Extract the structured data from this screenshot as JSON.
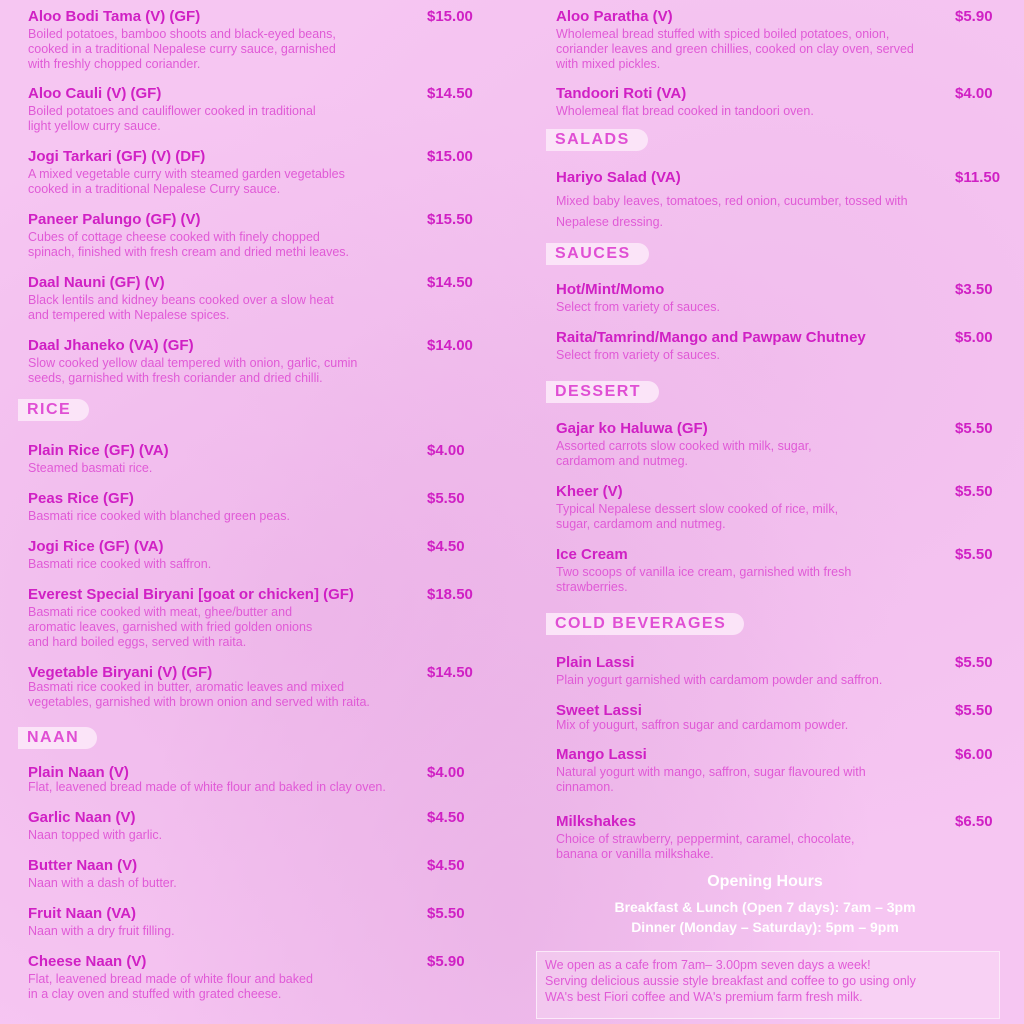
{
  "left": {
    "items": [
      {
        "name": "Aloo Bodi Tama (V) (GF)",
        "price": "$15.00",
        "desc": "Boiled potatoes, bamboo shoots and black-eyed beans,\ncooked in a traditional Nepalese curry sauce, garnished\nwith freshly chopped coriander."
      },
      {
        "name": "Aloo Cauli (V) (GF)",
        "price": "$14.50",
        "desc": "Boiled potatoes and cauliflower cooked in traditional\nlight yellow curry sauce."
      },
      {
        "name": "Jogi Tarkari (GF) (V) (DF)",
        "price": "$15.00",
        "desc": "A mixed vegetable curry with steamed garden vegetables\ncooked in a traditional Nepalese Curry sauce."
      },
      {
        "name": "Paneer Palungo (GF) (V)",
        "price": "$15.50",
        "desc": "Cubes of cottage cheese cooked with finely chopped\nspinach, finished with fresh cream and dried methi leaves."
      },
      {
        "name": "Daal Nauni (GF) (V)",
        "price": "$14.50",
        "desc": "Black lentils and kidney beans cooked over a slow heat\nand tempered with Nepalese spices."
      },
      {
        "name": "Daal Jhaneko (VA) (GF)",
        "price": "$14.00",
        "desc": "Slow cooked yellow daal tempered with onion, garlic, cumin\nseeds, garnished with fresh coriander and dried chilli."
      }
    ],
    "rice": {
      "title": "RICE",
      "items": [
        {
          "name": "Plain Rice (GF) (VA)",
          "price": "$4.00",
          "desc": "Steamed basmati rice."
        },
        {
          "name": "Peas Rice (GF)",
          "price": "$5.50",
          "desc": "Basmati rice cooked with blanched green peas."
        },
        {
          "name": "Jogi Rice (GF) (VA)",
          "price": "$4.50",
          "desc": "Basmati rice cooked with saffron."
        },
        {
          "name": "Everest Special Biryani [goat or chicken] (GF)",
          "price": "$18.50",
          "desc": "Basmati rice cooked with meat, ghee/butter and\naromatic leaves, garnished with fried golden onions\nand hard boiled eggs, served with raita."
        },
        {
          "name": "Vegetable Biryani (V) (GF)",
          "price": "$14.50",
          "desc": "Basmati rice cooked in butter, aromatic leaves and mixed\nvegetables, garnished with brown onion and served with raita."
        }
      ]
    },
    "naan": {
      "title": "NAAN",
      "items": [
        {
          "name": "Plain Naan (V)",
          "price": "$4.00",
          "desc": "Flat, leavened bread made of white flour and baked in clay oven."
        },
        {
          "name": "Garlic Naan (V)",
          "price": "$4.50",
          "desc": "Naan topped with garlic."
        },
        {
          "name": "Butter Naan (V)",
          "price": "$4.50",
          "desc": "Naan with a dash of butter."
        },
        {
          "name": "Fruit Naan (VA)",
          "price": "$5.50",
          "desc": "Naan with a dry fruit filling."
        },
        {
          "name": "Cheese Naan (V)",
          "price": "$5.90",
          "desc": "Flat, leavened bread made of white flour and baked\nin a clay oven and stuffed with grated cheese."
        }
      ]
    }
  },
  "right": {
    "items": [
      {
        "name": "Aloo Paratha (V)",
        "price": "$5.90",
        "desc": "Wholemeal bread stuffed with spiced boiled potatoes, onion,\ncoriander leaves and green chillies, cooked on clay oven, served\nwith mixed pickles."
      },
      {
        "name": "Tandoori Roti (VA)",
        "price": "$4.00",
        "desc": "Wholemeal flat bread cooked in tandoori oven."
      }
    ],
    "salads": {
      "title": "SALADS",
      "items": [
        {
          "name": "Hariyo Salad (VA)",
          "price": "$11.50",
          "desc": "Mixed baby leaves, tomatoes, red onion, cucumber, tossed with\nNepalese dressing."
        }
      ]
    },
    "sauces": {
      "title": "SAUCES",
      "items": [
        {
          "name": "Hot/Mint/Momo",
          "price": "$3.50",
          "desc": "Select from variety of sauces."
        },
        {
          "name": "Raita/Tamrind/Mango and Pawpaw Chutney",
          "price": "$5.00",
          "desc": "Select from variety of sauces."
        }
      ]
    },
    "dessert": {
      "title": "DESSERT",
      "items": [
        {
          "name": "Gajar ko Haluwa (GF)",
          "price": "$5.50",
          "desc": "Assorted carrots slow cooked with milk, sugar,\ncardamom and nutmeg."
        },
        {
          "name": "Kheer (V)",
          "price": "$5.50",
          "desc": "Typical Nepalese dessert slow cooked of rice, milk,\nsugar, cardamom and nutmeg."
        },
        {
          "name": "Ice Cream",
          "price": "$5.50",
          "desc": "Two scoops of vanilla ice cream, garnished with fresh\nstrawberries."
        }
      ]
    },
    "cold_beverages": {
      "title": "COLD BEVERAGES",
      "items": [
        {
          "name": "Plain Lassi",
          "price": "$5.50",
          "desc": "Plain yogurt garnished with cardamom powder and saffron."
        },
        {
          "name": "Sweet Lassi",
          "price": "$5.50",
          "desc": "Mix of yougurt, saffron sugar and cardamom powder."
        },
        {
          "name": "Mango Lassi",
          "price": "$6.00",
          "desc": "Natural yogurt with mango, saffron, sugar flavoured with\ncinnamon."
        },
        {
          "name": "Milkshakes",
          "price": "$6.50",
          "desc": "Choice of strawberry, peppermint, caramel, chocolate,\nbanana or vanilla milkshake."
        }
      ]
    }
  },
  "hours": {
    "title": "Opening Hours",
    "line1": "Breakfast & Lunch  (Open 7 days): 7am – 3pm",
    "line2": "Dinner (Monday – Saturday): 5pm – 9pm"
  },
  "note": "We open as a cafe from 7am– 3.00pm seven days a week!\nServing delicious aussie style breakfast and coffee to go using only\nWA's best Fiori coffee and WA's premium farm fresh milk."
}
